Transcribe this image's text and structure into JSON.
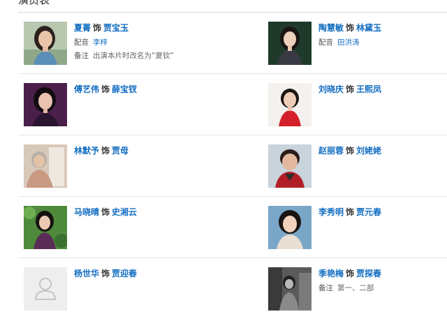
{
  "section": {
    "title": "演员表"
  },
  "as_word": "饰",
  "cast": [
    {
      "actor": "夏菁",
      "role": "贾宝玉",
      "photo": "photo-woman-long-hair",
      "meta": [
        {
          "key": "配音",
          "value": "李梓",
          "link": true
        },
        {
          "key": "备注",
          "value": "出演本片时改名为“夏钦”",
          "link": false
        }
      ]
    },
    {
      "actor": "陶慧敏",
      "role": "林黛玉",
      "photo": "photo-woman-dark-bg",
      "meta": [
        {
          "key": "配音",
          "value": "田洪涛",
          "link": true
        }
      ]
    },
    {
      "actor": "傅艺伟",
      "role": "薛宝钗",
      "photo": "photo-woman-purple-bg",
      "meta": []
    },
    {
      "actor": "刘晓庆",
      "role": "王熙凤",
      "photo": "photo-woman-red-dress",
      "meta": []
    },
    {
      "actor": "林默予",
      "role": "贾母",
      "photo": "photo-elderly-woman-seated",
      "meta": []
    },
    {
      "actor": "赵丽蓉",
      "role": "刘姥姥",
      "photo": "photo-elderly-woman-laughing",
      "meta": []
    },
    {
      "actor": "马晓晴",
      "role": "史湘云",
      "photo": "photo-woman-garden",
      "meta": []
    },
    {
      "actor": "李秀明",
      "role": "贾元春",
      "photo": "photo-woman-smiling",
      "meta": []
    },
    {
      "actor": "杨世华",
      "role": "贾迎春",
      "photo": "photo-placeholder",
      "meta": []
    },
    {
      "actor": "季艳梅",
      "role": "贾探春",
      "photo": "photo-black-white",
      "meta": [
        {
          "key": "备注",
          "value": "第一、二部",
          "link": false
        }
      ]
    }
  ],
  "colors": {
    "link": "#136ec2",
    "divider": "#e6e6e6",
    "text": "#333333"
  }
}
